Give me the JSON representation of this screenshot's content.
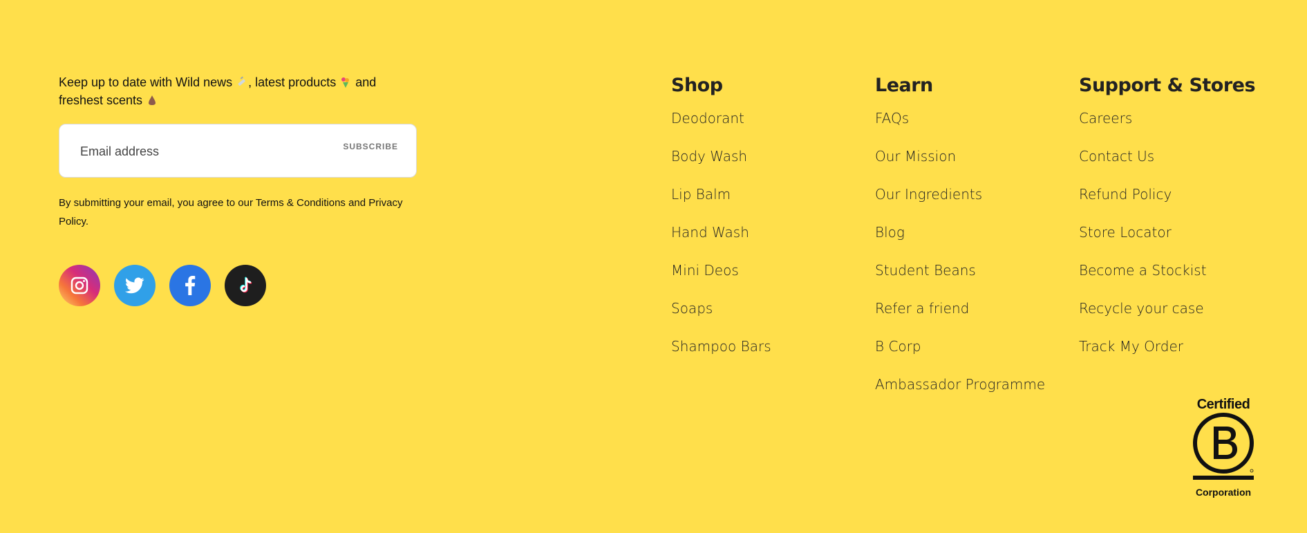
{
  "newsletter": {
    "text_part1": "Keep up to date with Wild news",
    "text_part2": ", latest products",
    "text_part3": " and freshest scents",
    "email_placeholder": "Email address",
    "subscribe_label": "SUBSCRIBE",
    "disclaimer": "By submitting your email, you agree to our Terms & Conditions and Privacy Policy."
  },
  "social": [
    {
      "name": "instagram-icon",
      "color": "#d72d79"
    },
    {
      "name": "twitter-icon",
      "color": "#30a0e8"
    },
    {
      "name": "facebook-icon",
      "color": "#2a75e4"
    },
    {
      "name": "tiktok-icon",
      "color": "#1e1e1e"
    }
  ],
  "shop": {
    "heading": "Shop",
    "items": [
      "Deodorant",
      "Body Wash",
      "Lip Balm",
      "Hand Wash",
      "Mini Deos",
      "Soaps",
      "Shampoo Bars"
    ]
  },
  "learn": {
    "heading": "Learn",
    "items": [
      "FAQs",
      "Our Mission",
      "Our Ingredients",
      "Blog",
      "Student Beans",
      "Refer a friend",
      "B Corp",
      "Ambassador Programme"
    ]
  },
  "support": {
    "heading": "Support & Stores",
    "items": [
      "Careers",
      "Contact Us",
      "Refund Policy",
      "Store Locator",
      "Become a Stockist",
      "Recycle your case",
      "Track My Order"
    ]
  },
  "bcorp": {
    "top": "Certified",
    "bottom": "Corporation"
  },
  "colors": {
    "background": "#ffdf4b",
    "text": "#222222"
  }
}
